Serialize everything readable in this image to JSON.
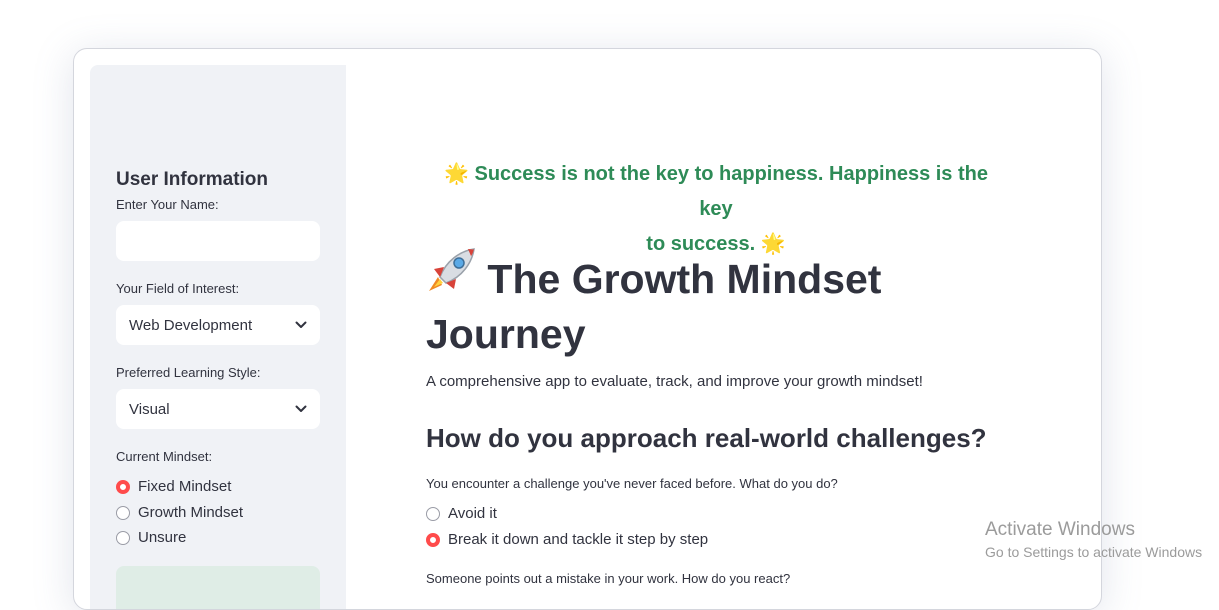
{
  "sidebar": {
    "title": "User Information",
    "name_label": "Enter Your Name:",
    "name_value": "",
    "field_label": "Your Field of Interest:",
    "field_value": "Web Development",
    "style_label": "Preferred Learning Style:",
    "style_value": "Visual",
    "mindset_label": "Current Mindset:",
    "mindset_options": [
      "Fixed Mindset",
      "Growth Mindset",
      "Unsure"
    ],
    "mindset_selected": "Fixed Mindset"
  },
  "main": {
    "quote_line1": "Success is not the key to happiness. Happiness is the key",
    "quote_line2": "to success.",
    "title_line1": "The Growth Mindset",
    "title_line2": "Journey",
    "subtitle": "A comprehensive app to evaluate, track, and improve your growth mindset!",
    "section_heading": "How do you approach real-world challenges?",
    "question1": "You encounter a challenge you've never faced before. What do you do?",
    "question1_options": [
      "Avoid it",
      "Break it down and tackle it step by step"
    ],
    "question1_selected": "Break it down and tackle it step by step",
    "question2": "Someone points out a mistake in your work. How do you react?"
  },
  "watermark": {
    "line1": "Activate Windows",
    "line2": "Go to Settings to activate Windows"
  },
  "colors": {
    "accent": "#ff4b4b",
    "quote": "#2e8b57",
    "sidebar_bg": "#f0f2f6",
    "text": "#31333f"
  },
  "icons": [
    "star-icon",
    "rocket-icon",
    "chevron-down-icon"
  ]
}
